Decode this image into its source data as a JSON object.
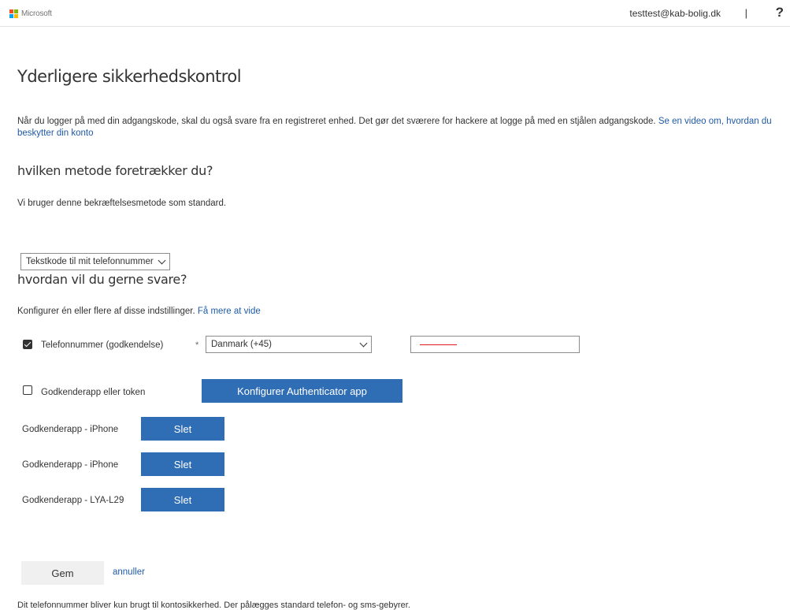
{
  "header": {
    "brand": "Microsoft",
    "user_email": "testtest@kab-bolig.dk",
    "separator": "|",
    "help": "?"
  },
  "page": {
    "title": "Yderligere sikkerhedskontrol",
    "intro_text": "Når du logger på med din adgangskode, skal du også svare fra en registreret enhed. Det gør det sværere for hackere at logge på med en stjålen adgangskode.",
    "intro_link": "Se en video om, hvordan du beskytter din konto"
  },
  "method": {
    "heading": "hvilken metode foretrækker du?",
    "description": "Vi bruger denne bekræftelsesmetode som standard.",
    "selected": "Tekstkode til mit telefonnummer"
  },
  "respond": {
    "heading": "hvordan vil du gerne svare?",
    "description": "Konfigurer én eller flere af disse indstillinger.",
    "learn_more": "Få mere at vide",
    "phone_label": "Telefonnummer (godkendelse)",
    "phone_checked": true,
    "required_mark": "*",
    "country": "Danmark (+45)",
    "app_label": "Godkenderapp eller token",
    "app_checked": false,
    "configure_button": "Konfigurer Authenticator app"
  },
  "devices": [
    {
      "name": "Godkenderapp - iPhone",
      "button": "Slet"
    },
    {
      "name": "Godkenderapp - iPhone",
      "button": "Slet"
    },
    {
      "name": "Godkenderapp - LYA-L29",
      "button": "Slet"
    }
  ],
  "actions": {
    "save": "Gem",
    "cancel": "annuller"
  },
  "footer_note": "Dit telefonnummer bliver kun brugt til kontosikkerhed. Der pålægges standard telefon- og sms-gebyrer.",
  "colors": {
    "accent_blue": "#2f6db5",
    "link_blue": "#1f5aa6",
    "logo_red": "#f25022",
    "logo_green": "#7fba00",
    "logo_blue": "#00a4ef",
    "logo_yellow": "#ffb900"
  }
}
